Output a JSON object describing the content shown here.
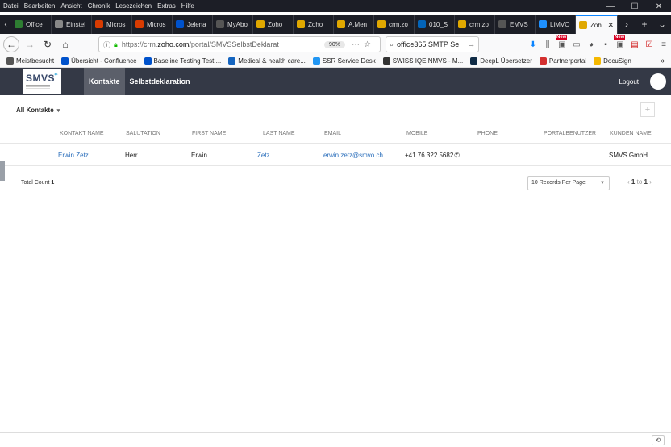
{
  "menu": [
    "Datei",
    "Bearbeiten",
    "Ansicht",
    "Chronik",
    "Lesezeichen",
    "Extras",
    "Hilfe"
  ],
  "window_controls": [
    "—",
    "☐",
    "✕"
  ],
  "tabs": [
    {
      "label": "Office",
      "color": "#2e7d32"
    },
    {
      "label": "Einstel",
      "color": "#888888"
    },
    {
      "label": "Micros",
      "color": "#d83b01"
    },
    {
      "label": "Micros",
      "color": "#d83b01"
    },
    {
      "label": "Jelena",
      "color": "#0052cc"
    },
    {
      "label": "MyAbo",
      "color": "#555555"
    },
    {
      "label": "Zoho",
      "color": "#e0a800"
    },
    {
      "label": "Zoho",
      "color": "#e0a800"
    },
    {
      "label": "A.Men",
      "color": "#e0a800"
    },
    {
      "label": "crm.zo",
      "color": "#e0a800"
    },
    {
      "label": "010_S",
      "color": "#0364b8"
    },
    {
      "label": "crm.zo",
      "color": "#e0a800"
    },
    {
      "label": "EMVS",
      "color": "#555555"
    },
    {
      "label": "LiMVO",
      "color": "#1e90ff"
    },
    {
      "label": "Zoh",
      "color": "#e0a800",
      "active": true
    }
  ],
  "nav": {
    "url_prefix": "https://crm.",
    "url_host": "zoho.com",
    "url_rest": "/portal/SMVSSelbstDeklarat",
    "zoom": "90%",
    "search_value": "office365 SMTP Se"
  },
  "bookmarks": [
    {
      "label": "Meistbesucht",
      "color": "#555555"
    },
    {
      "label": "Übersicht - Confluence",
      "color": "#0052cc"
    },
    {
      "label": "Baseline Testing Test ...",
      "color": "#0052cc"
    },
    {
      "label": "Medical & health care...",
      "color": "#1565c0"
    },
    {
      "label": "SSR Service Desk",
      "color": "#2196f3"
    },
    {
      "label": "SWISS IQE NMVS - M...",
      "color": "#333333"
    },
    {
      "label": "DeepL Übersetzer",
      "color": "#0f2b46"
    },
    {
      "label": "Partnerportal",
      "color": "#d32f2f"
    },
    {
      "label": "DocuSign",
      "color": "#f5b800"
    }
  ],
  "app": {
    "logo_text": "SMVS",
    "nav_tabs": [
      "Kontakte",
      "Selbstdeklaration"
    ],
    "logout": "Logout"
  },
  "list": {
    "view_name": "All Kontakte",
    "add_label": "+",
    "columns": [
      "KONTAKT NAME",
      "SALUTATION",
      "FIRST NAME",
      "LAST NAME",
      "EMAIL",
      "MOBILE",
      "PHONE",
      "PORTALBENUTZER",
      "KUNDEN NAME"
    ],
    "rows": [
      {
        "kontakt_name": "Erwin Zetz",
        "salutation": "Herr",
        "first_name": "Erwin",
        "last_name": "Zetz",
        "email": "erwin.zetz@smvo.ch",
        "mobile": "+41 76 322 5682",
        "phone": "",
        "portalbenutzer": "",
        "kunden_name": "SMVS GmbH"
      }
    ],
    "total_label": "Total Count",
    "total_count": "1",
    "per_page": "10 Records Per Page",
    "page_from": "1",
    "page_to_label": "to",
    "page_to": "1"
  }
}
